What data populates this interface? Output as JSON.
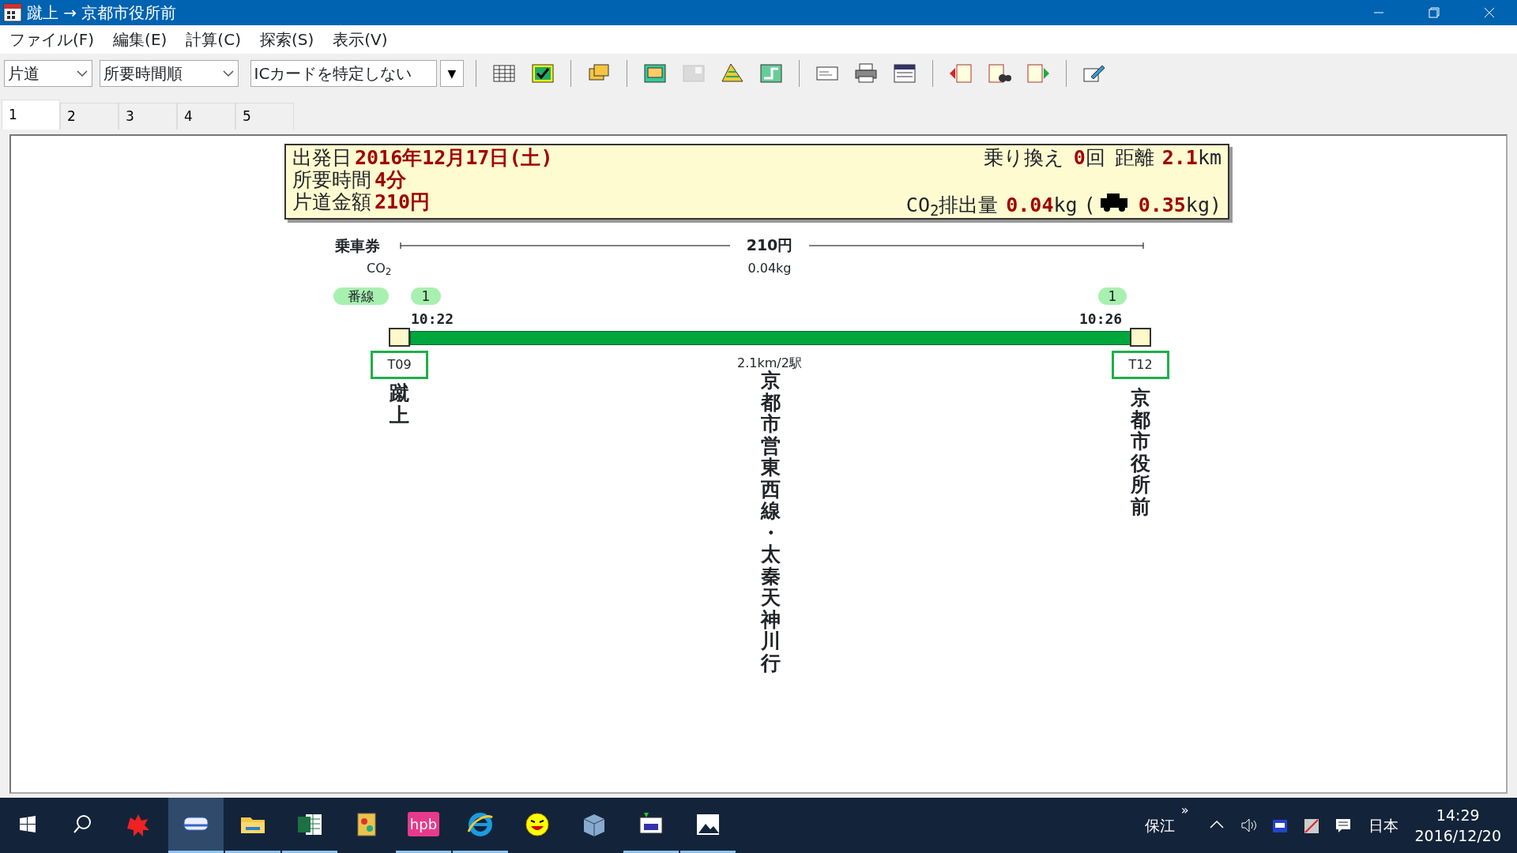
{
  "window": {
    "title": "蹴上 → 京都市役所前"
  },
  "menu": [
    {
      "label": "ファイル(F)"
    },
    {
      "label": "編集(E)"
    },
    {
      "label": "計算(C)"
    },
    {
      "label": "探索(S)"
    },
    {
      "label": "表示(V)"
    }
  ],
  "toolbar": {
    "trip_type": "片道",
    "sort": "所要時間順",
    "ic_card": "ICカードを特定しない",
    "ic_arrow": "▼",
    "groups": [
      [
        {
          "kind": "grid",
          "disabled": false
        },
        {
          "kind": "check",
          "disabled": false
        }
      ],
      [
        {
          "kind": "windows",
          "disabled": false
        }
      ],
      [
        {
          "kind": "board",
          "disabled": false
        },
        {
          "kind": "card",
          "disabled": true
        },
        {
          "kind": "map",
          "disabled": false
        },
        {
          "kind": "route",
          "disabled": false
        }
      ],
      [
        {
          "kind": "mail",
          "disabled": false
        },
        {
          "kind": "printer",
          "disabled": false
        },
        {
          "kind": "timetable",
          "disabled": false
        }
      ],
      [
        {
          "kind": "prev",
          "disabled": false
        },
        {
          "kind": "find",
          "disabled": false
        },
        {
          "kind": "next",
          "disabled": false
        }
      ],
      [
        {
          "kind": "edit",
          "disabled": false
        }
      ]
    ]
  },
  "tabs": [
    {
      "label": "1",
      "selected": true
    },
    {
      "label": "2",
      "selected": false
    },
    {
      "label": "3",
      "selected": false
    },
    {
      "label": "4",
      "selected": false
    },
    {
      "label": "5",
      "selected": false
    }
  ],
  "summary": {
    "date_label": "出発日",
    "date": "2016年12月17日(土)",
    "duration_label": "所要時間",
    "duration": "4分",
    "fare_label": "片道金額",
    "fare": "210円",
    "transfers_label": "乗り換え",
    "transfers": "0",
    "transfers_unit": "回",
    "distance_label": "距離",
    "distance": "2.1",
    "distance_unit": "km",
    "co2_label": "CO$_{2}$排出量",
    "co2": "0.04",
    "co2_unit": "kg",
    "car_open": "(",
    "car_co2": "0.35",
    "car_close": "kg)"
  },
  "route": {
    "ticket_label": "乗車券",
    "ticket_fare": "210円",
    "co2_label": "CO$_{2}$",
    "co2": "0.04kg",
    "platform_label": "番線",
    "segment": {
      "depart_platform": "1",
      "arrive_platform": "1",
      "depart_time": "10:22",
      "arrive_time": "10:26",
      "distance": "2.1km/2駅",
      "line": "京都市営東西線・太秦天神川行"
    },
    "stations": [
      {
        "code": "T09",
        "name": "蹴上"
      },
      {
        "code": "T12",
        "name": "京都市役所前"
      }
    ]
  },
  "taskbar": {
    "apps": [
      {
        "kind": "redblob",
        "running": false,
        "active": false
      },
      {
        "kind": "train",
        "running": true,
        "active": true
      },
      {
        "kind": "folder",
        "running": true,
        "active": false
      },
      {
        "kind": "sheet",
        "running": true,
        "active": false
      },
      {
        "kind": "book",
        "running": false,
        "active": false
      },
      {
        "kind": "hpb",
        "label": "hpb",
        "running": true,
        "active": false
      },
      {
        "kind": "browser",
        "running": true,
        "active": false
      },
      {
        "kind": "smiley",
        "running": false,
        "active": false
      },
      {
        "kind": "box",
        "running": false,
        "active": false
      },
      {
        "kind": "letter",
        "running": true,
        "active": false
      },
      {
        "kind": "photo",
        "running": true,
        "active": false
      }
    ],
    "tray_text": "保江",
    "tray_more": "»",
    "ime": "日本",
    "time": "14:29",
    "date": "2016/12/20"
  }
}
